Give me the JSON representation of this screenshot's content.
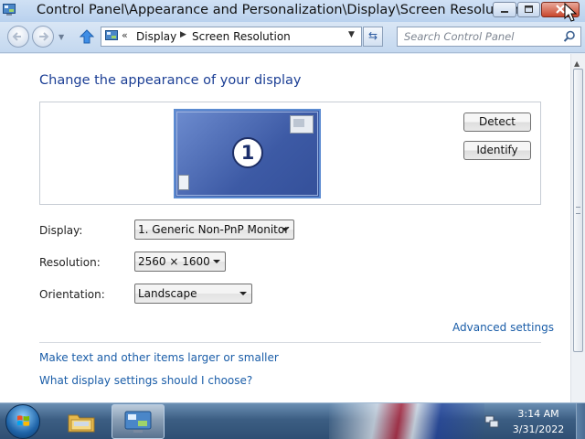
{
  "window": {
    "title": "Control Panel\\Appearance and Personalization\\Display\\Screen Resolution"
  },
  "navbar": {
    "breadcrumbs": [
      "Display",
      "Screen Resolution"
    ],
    "search_placeholder": "Search Control Panel"
  },
  "main": {
    "heading": "Change the appearance of your display",
    "monitor_number": "1",
    "detect_label": "Detect",
    "identify_label": "Identify",
    "display_label": "Display:",
    "display_value": "1. Generic Non-PnP Monitor",
    "resolution_label": "Resolution:",
    "resolution_value": "2560 × 1600",
    "orientation_label": "Orientation:",
    "orientation_value": "Landscape",
    "advanced_link": "Advanced settings",
    "larger_link": "Make text and other items larger or smaller",
    "help_link": "What display settings should I choose?"
  },
  "taskbar": {
    "time": "3:14 AM",
    "date": "3/31/2022"
  },
  "colors": {
    "heading": "#1c3f95",
    "link": "#1a5da8",
    "monitor_fill": "#3d5aa5"
  },
  "icons": [
    "control-panel-icon",
    "back-icon",
    "forward-icon",
    "up-arrow-icon",
    "refresh-icon",
    "search-icon",
    "windows-start-icon",
    "explorer-folder-icon",
    "network-icon"
  ]
}
